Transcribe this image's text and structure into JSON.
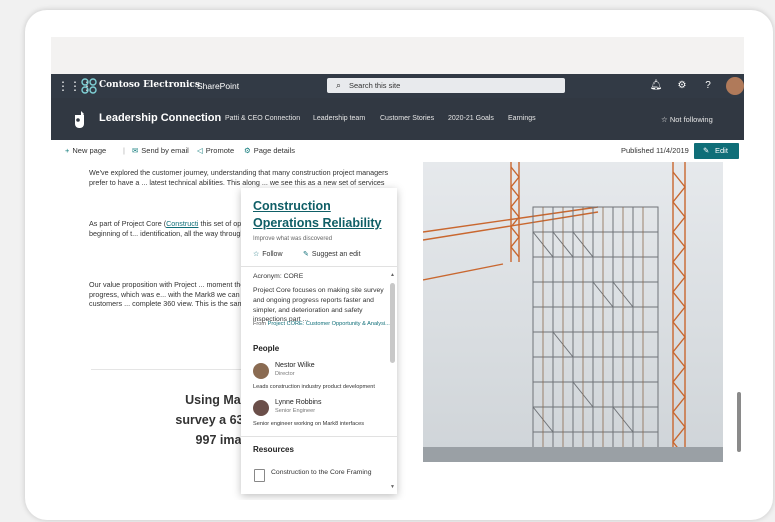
{
  "suite_bar": {
    "brand": "Contoso Electronics",
    "app": "SharePoint",
    "search_placeholder": "Search this site"
  },
  "site_header": {
    "title": "Leadership Connection",
    "nav": [
      "Patti & CEO Connection",
      "Leadership team",
      "Customer Stories",
      "2020-21 Goals",
      "Earnings"
    ],
    "follow": "Not following"
  },
  "command_bar": {
    "new_page": "New page",
    "send_by_email": "Send by email",
    "promote": "Promote",
    "page_details": "Page details",
    "published": "Published 11/4/2019",
    "edit": "Edit"
  },
  "article": {
    "para1": "We've explored the customer journey, understanding that many construction project managers prefer to have a ... latest technical abilities. This along ... we see this as a new set of services",
    "para2_start": "As part of Project Core (",
    "para2_link": "Constructi",
    "para2_rest": " this set of opportunities on how o... their work from the beginning of t... identification, all the way through t... insurance documentation.",
    "para3": "Our value proposition with Project ... moment the project is underway. I... construction progress, which was e... with the Mark8 we can support the... models also allows our customers ... complete 360 view. This is the sam...",
    "quote_lines": [
      "Using Mark8 sc",
      "survey a 63 acre si",
      "997 images,"
    ]
  },
  "topic_card": {
    "title": "Construction Operations Reliability",
    "subtitle": "Improve what was discovered",
    "follow": "Follow",
    "suggest": "Suggest an edit",
    "acronym": "Acronym: CORE",
    "description": "Project Core focuses on making site survey and ongoing progress reports faster and simpler, and deterioration and safety inspections part ...",
    "from_label": "From",
    "from_link": "Project CORE: Customer Opportunity & Analysi...",
    "people_heading": "People",
    "people": [
      {
        "name": "Nestor Wilke",
        "role": "Director",
        "desc": "Leads construction industry product development",
        "color": "#8a6b52"
      },
      {
        "name": "Lynne Robbins",
        "role": "Senior Engineer",
        "desc": "Senior engineer working on Mark8 interfaces",
        "color": "#6b4f4a"
      }
    ],
    "resources_heading": "Resources",
    "resource_item": "Construction to the Core Framing"
  },
  "colors": {
    "suite_bar": "#323a45",
    "site_header": "#313842",
    "accent": "#0f6e78"
  }
}
